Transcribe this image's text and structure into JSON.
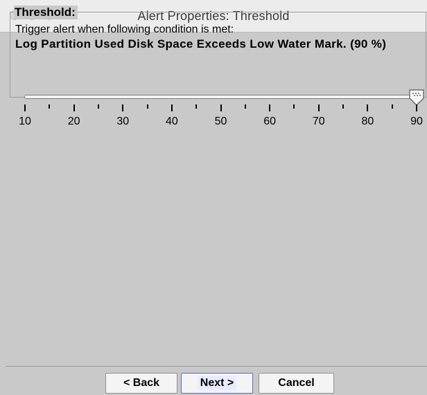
{
  "window": {
    "title": "Alert Properties: Threshold"
  },
  "threshold": {
    "legend": "Threshold:",
    "instruction": "Trigger alert when following condition is met:",
    "condition": "Log Partition Used Disk Space Exceeds Low Water Mark. (90 %)",
    "slider": {
      "min": 10,
      "max": 90,
      "value": 90,
      "major_step": 10,
      "minor_step": 5,
      "labels": [
        "10",
        "20",
        "30",
        "40",
        "50",
        "60",
        "70",
        "80",
        "90"
      ]
    }
  },
  "buttons": {
    "back": "< Back",
    "next": "Next >",
    "cancel": "Cancel"
  },
  "icons": {
    "close": "close-dot",
    "minimize": "minimize-dot",
    "zoom": "zoom-dot"
  }
}
